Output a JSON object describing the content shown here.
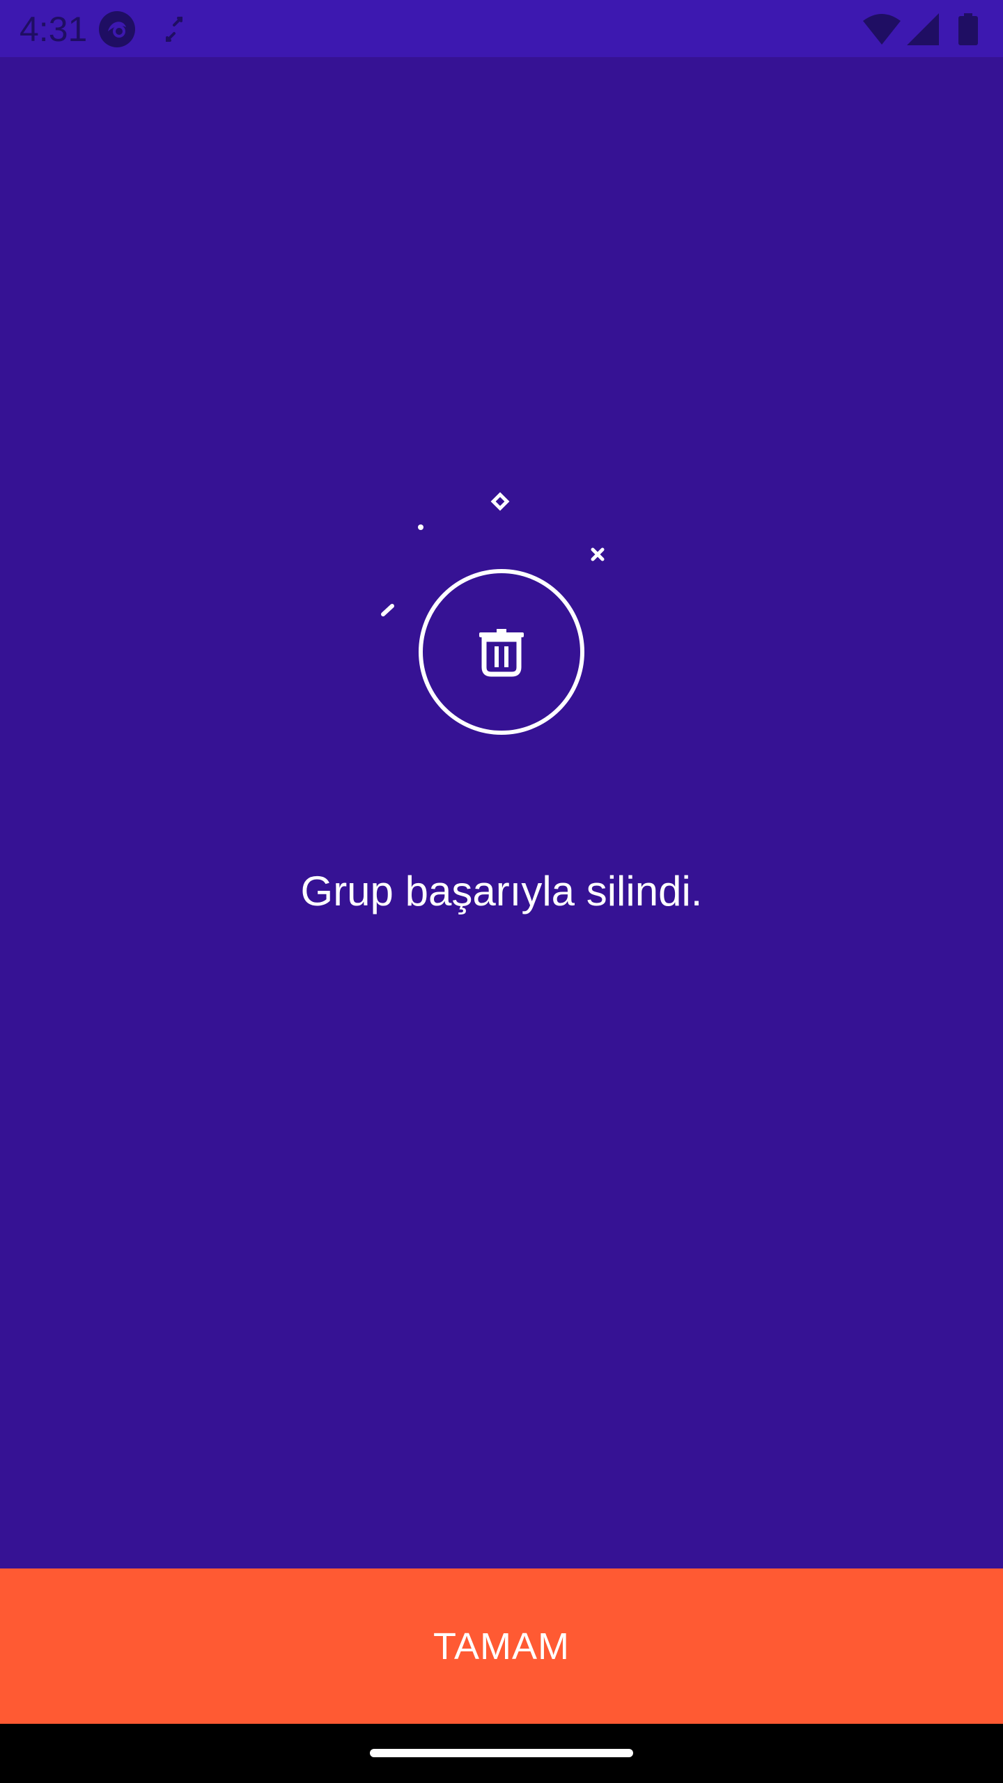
{
  "status_bar": {
    "time": "4:31",
    "icons": [
      "app-notification-icon",
      "screen-rotate-icon",
      "wifi-icon",
      "cellular-signal-icon",
      "battery-icon"
    ]
  },
  "illustration": {
    "icon": "trash-icon",
    "decorations": [
      "diamond-sparkle-icon",
      "dot-sparkle-icon",
      "x-sparkle-icon",
      "dash-sparkle-icon"
    ]
  },
  "message": "Grup başarıyla silindi.",
  "ok_button": {
    "label": "TAMAM"
  },
  "colors": {
    "background": "#361294",
    "status_bar": "#3d18b0",
    "button": "#ff5a33",
    "text": "#ffffff"
  }
}
